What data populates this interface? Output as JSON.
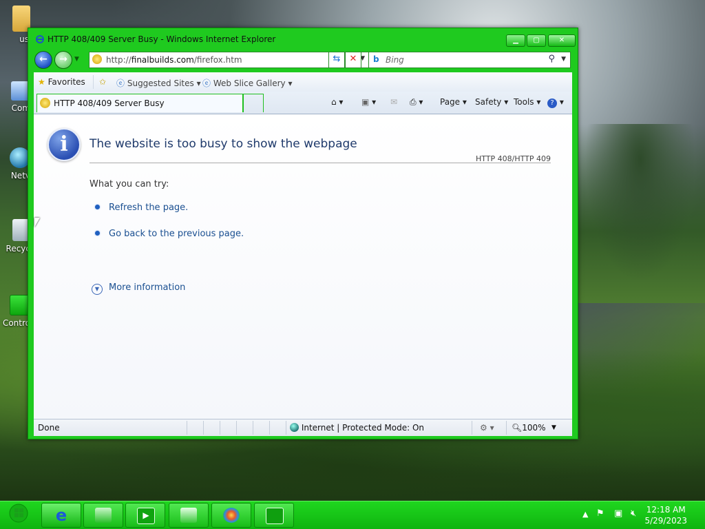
{
  "desktop": {
    "icons": [
      {
        "label": "us",
        "name": "user-folder"
      },
      {
        "label": "Com",
        "name": "computer"
      },
      {
        "label": "Netv",
        "name": "network"
      },
      {
        "label": "Recyc",
        "name": "recycle-bin"
      },
      {
        "label": "Contro",
        "name": "control-panel"
      }
    ]
  },
  "window": {
    "title": "HTTP 408/409 Server Busy - Windows Internet Explorer",
    "address": {
      "prefix": "http://",
      "domain": "finalbuilds.com",
      "path": "/firefox.htm"
    },
    "search": {
      "placeholder": "Bing"
    },
    "favorites_bar": {
      "favorites": "Favorites",
      "suggested": "Suggested Sites",
      "gallery": "Web Slice Gallery"
    },
    "tab": {
      "title": "HTTP 408/409 Server Busy"
    },
    "commands": {
      "page": "Page",
      "safety": "Safety",
      "tools": "Tools"
    },
    "content": {
      "heading": "The website is too busy to show the webpage",
      "code": "HTTP 408/HTTP 409",
      "try_label": "What you can try:",
      "links": [
        "Refresh the page.",
        "Go back to the previous page."
      ],
      "more": "More information"
    },
    "status": {
      "left": "Done",
      "zone": "Internet | Protected Mode: On",
      "zoom": "100%"
    }
  },
  "taskbar": {
    "time": "12:18 AM",
    "date": "5/29/2023"
  },
  "colors": {
    "chrome_green": "#1fca1f",
    "link_blue": "#1a4f91",
    "heading_blue": "#1f3a6b"
  }
}
